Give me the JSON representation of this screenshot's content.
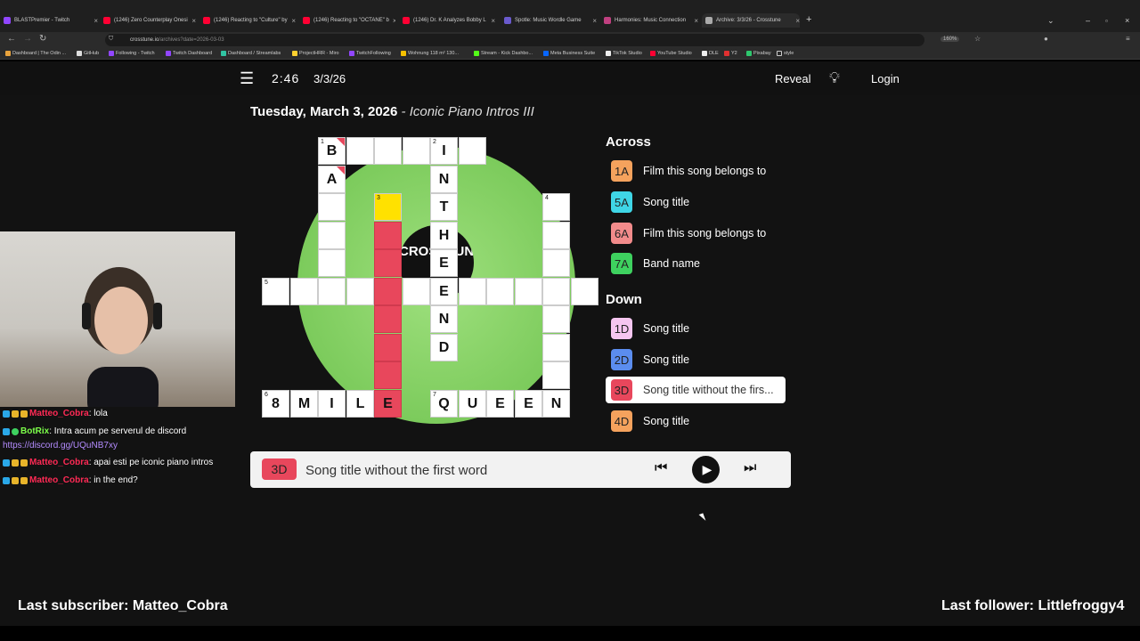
{
  "browser": {
    "tabs": [
      {
        "label": "BLASTPremier - Twitch",
        "color": "#9146ff"
      },
      {
        "label": "(1246) Zero Counterplay Onesi",
        "color": "#ff0033"
      },
      {
        "label": "(1246) Reacting to \"Culture\" by",
        "color": "#ff0033"
      },
      {
        "label": "(1246) Reacting to \"OCTANE\" b",
        "color": "#ff0033"
      },
      {
        "label": "(1246) Dr. K Analyzes Bobby L",
        "color": "#ff0033"
      },
      {
        "label": "Spotle: Music Wordle Game",
        "color": "#6a5acd"
      },
      {
        "label": "Harmonies: Music Connection",
        "color": "#c04080"
      },
      {
        "label": "Archive: 3/3/26 - Crosstune",
        "color": "#aaaaaa"
      }
    ],
    "url_host": "crosstune.io",
    "url_path": "/archives?date=2026-03-03",
    "zoom": "160%",
    "bookmarks": [
      "Dashboard | The Odin ...",
      "GitHub",
      "Following - Twitch",
      "Twitch Dashboard",
      "Dashboard / Streamlabs",
      "ProjectHRR - Miro",
      "TwitchFollowing",
      "Wohnung 118 m² 130...",
      "Stream - Kick Dashbo...",
      "Meta Business Suite",
      "TikTok Studio",
      "YouTube Studio",
      "DLE",
      "Y2",
      "Pixabay",
      "style"
    ]
  },
  "header": {
    "timer": "2:46",
    "date": "3/3/26",
    "reveal": "Reveal",
    "login": "Login"
  },
  "puzzle": {
    "date_title": "Tuesday, March 3, 2026",
    "separator": " - ",
    "subtitle": "Iconic Piano Intros III",
    "disc_label": "CROSSTUNE"
  },
  "grid": {
    "b1": "B",
    "a1": "A",
    "i2": "I",
    "n2": "N",
    "t2": "T",
    "h2": "H",
    "e2": "E",
    "e2b": "E",
    "n2b": "N",
    "d2": "D",
    "m6": "8",
    "m6b": "M",
    "m6c": "I",
    "m6d": "L",
    "m6e": "E",
    "q7": "Q",
    "q7b": "U",
    "q7c": "E",
    "q7d": "E",
    "q7e": "N",
    "n1": "1",
    "n2n": "2",
    "n3": "3",
    "n4": "4",
    "n5": "5",
    "n6": "6",
    "n7": "7"
  },
  "clues": {
    "across_title": "Across",
    "down_title": "Down",
    "across": [
      {
        "num": "1A",
        "text": "Film this song belongs to",
        "color": "#f5a25d"
      },
      {
        "num": "5A",
        "text": "Song title",
        "color": "#3fd6e6"
      },
      {
        "num": "6A",
        "text": "Film this song belongs to",
        "color": "#f28b8b"
      },
      {
        "num": "7A",
        "text": "Band name",
        "color": "#3ed15f"
      }
    ],
    "down": [
      {
        "num": "1D",
        "text": "Song title",
        "color": "#f6c6f0"
      },
      {
        "num": "2D",
        "text": "Song title",
        "color": "#5b8def"
      },
      {
        "num": "3D",
        "text": "Song title without the firs...",
        "color": "#e8475c"
      },
      {
        "num": "4D",
        "text": "Song title",
        "color": "#f5a25d"
      }
    ]
  },
  "player": {
    "clue_num": "3D",
    "clue_text": "Song title without the first word"
  },
  "chat": [
    {
      "user": "Matteo_Cobra",
      "msg": ": lola"
    },
    {
      "user": "BotRix",
      "msg": ": Intra acum pe serverul de discord"
    },
    {
      "link": "https://discord.gg/UQuNB7xy"
    },
    {
      "user": "Matteo_Cobra",
      "msg": ": apai esti pe iconic piano intros"
    },
    {
      "user": "Matteo_Cobra",
      "msg": ": in the end?"
    }
  ],
  "overlay": {
    "last_subscriber": "Last subscriber: Matteo_Cobra",
    "last_follower": "Last follower: Littlefroggy4"
  }
}
